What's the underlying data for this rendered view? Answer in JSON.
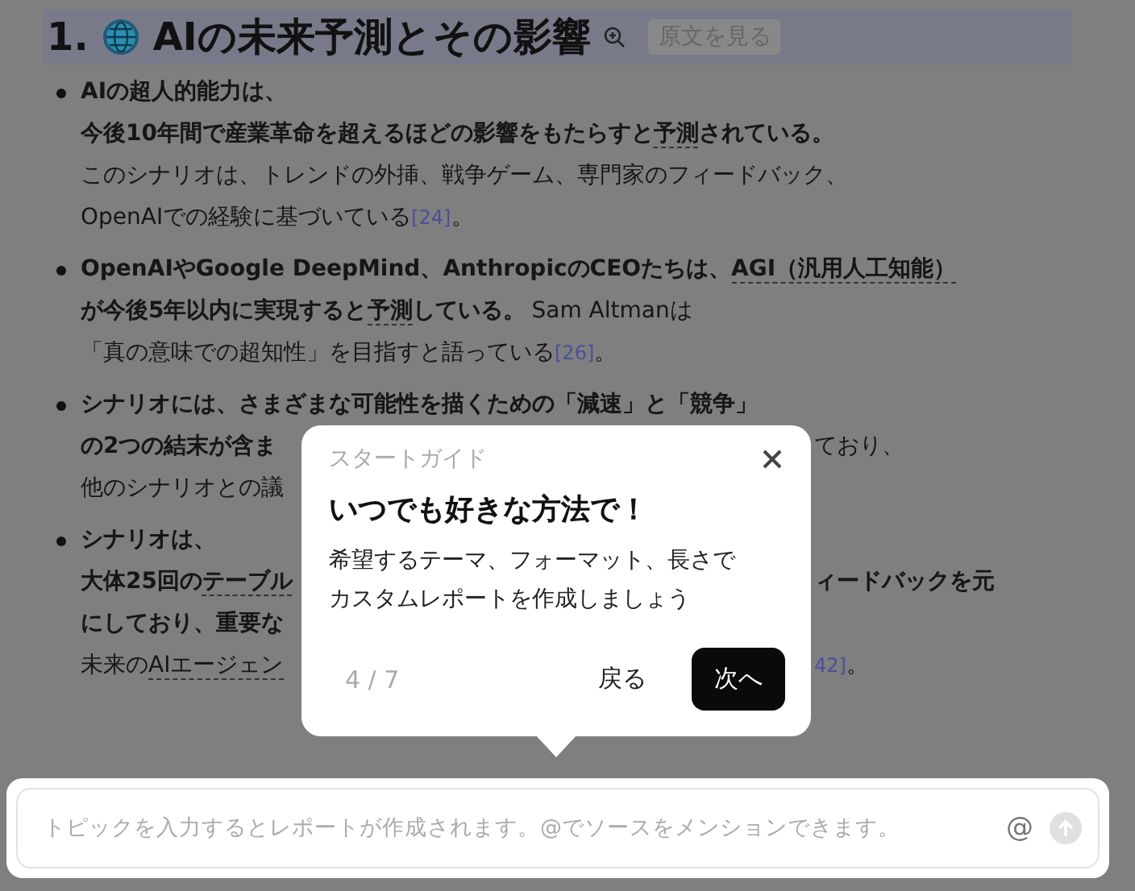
{
  "section": {
    "number": "1.",
    "title": "AIの未来予測とその影響",
    "source_button": "原文を見る"
  },
  "bullets": [
    {
      "lines": [
        {
          "left": [
            {
              "text": "AIの超人的能力は、",
              "kind": "bold",
              "underline": false
            }
          ]
        },
        {
          "left": [
            {
              "text": "今後10年間で産業革命を超えるほどの影響をもたらすと",
              "kind": "bold",
              "underline": false
            },
            {
              "text": "予測",
              "kind": "bold",
              "underline": true
            },
            {
              "text": "されている。",
              "kind": "bold",
              "underline": false
            }
          ]
        },
        {
          "left": [
            {
              "text": "このシナリオは、トレンドの外挿、戦争ゲーム、専門家のフィードバック、",
              "kind": "plain",
              "underline": false
            }
          ]
        },
        {
          "left": [
            {
              "text": "OpenAIでの経験に基づいている",
              "kind": "plain",
              "underline": false
            },
            {
              "text": "[24]",
              "kind": "ref",
              "underline": false
            },
            {
              "text": "。",
              "kind": "plain",
              "underline": false
            }
          ]
        }
      ]
    },
    {
      "lines": [
        {
          "left": [
            {
              "text": "OpenAIやGoogle DeepMind、AnthropicのCEOたちは、",
              "kind": "bold",
              "underline": false
            },
            {
              "text": "AGI（汎用人工知能）",
              "kind": "bold",
              "underline": true
            }
          ]
        },
        {
          "left": [
            {
              "text": "が今後5年以内に実現すると",
              "kind": "bold",
              "underline": false
            },
            {
              "text": "予測",
              "kind": "bold",
              "underline": true
            },
            {
              "text": "している。",
              "kind": "bold",
              "underline": false
            },
            {
              "text": "Sam Altmanは",
              "kind": "plain",
              "underline": false
            }
          ]
        },
        {
          "left": [
            {
              "text": "「真の意味での超知性」を目指すと語っている",
              "kind": "plain",
              "underline": false
            },
            {
              "text": "[26]",
              "kind": "ref",
              "underline": false
            },
            {
              "text": "。",
              "kind": "plain",
              "underline": false
            }
          ]
        }
      ]
    },
    {
      "lines": [
        {
          "left": [
            {
              "text": "シナリオには、さまざまな可能性を描くための「減速」と「競争」",
              "kind": "bold",
              "underline": false
            }
          ]
        },
        {
          "left": [
            {
              "text": "の2つの結末が含ま",
              "kind": "bold",
              "underline": false
            }
          ],
          "right": [
            {
              "text": "ており、",
              "kind": "plain",
              "underline": false
            }
          ]
        },
        {
          "left": [
            {
              "text": "他のシナリオとの議",
              "kind": "plain",
              "underline": false
            }
          ]
        }
      ]
    },
    {
      "lines": [
        {
          "left": [
            {
              "text": "シナリオは、",
              "kind": "bold",
              "underline": false
            }
          ]
        },
        {
          "left": [
            {
              "text": "大体25回の",
              "kind": "bold",
              "underline": false
            },
            {
              "text": "テーブル",
              "kind": "bold",
              "underline": true
            }
          ],
          "right": [
            {
              "text": "ィードバックを元",
              "kind": "bold",
              "underline": false
            }
          ]
        },
        {
          "left": [
            {
              "text": "にしており、重要な",
              "kind": "bold",
              "underline": false
            }
          ]
        },
        {
          "left": [
            {
              "text": "未来の",
              "kind": "plain",
              "underline": false
            },
            {
              "text": "AIエージェン",
              "kind": "plain",
              "underline": true
            }
          ],
          "right": [
            {
              "text": "42]",
              "kind": "ref",
              "underline": false
            },
            {
              "text": "。",
              "kind": "plain",
              "underline": false
            }
          ]
        }
      ]
    }
  ],
  "guide": {
    "label": "スタートガイド",
    "title": "いつでも好きな方法で！",
    "body": [
      "希望するテーマ、フォーマット、長さで",
      "カスタムレポートを作成しましょう"
    ],
    "step": "4 / 7",
    "back": "戻る",
    "next": "次へ"
  },
  "input": {
    "placeholder": "トピックを入力するとレポートが作成されます。@でソースをメンションできます。",
    "mention": "@"
  }
}
